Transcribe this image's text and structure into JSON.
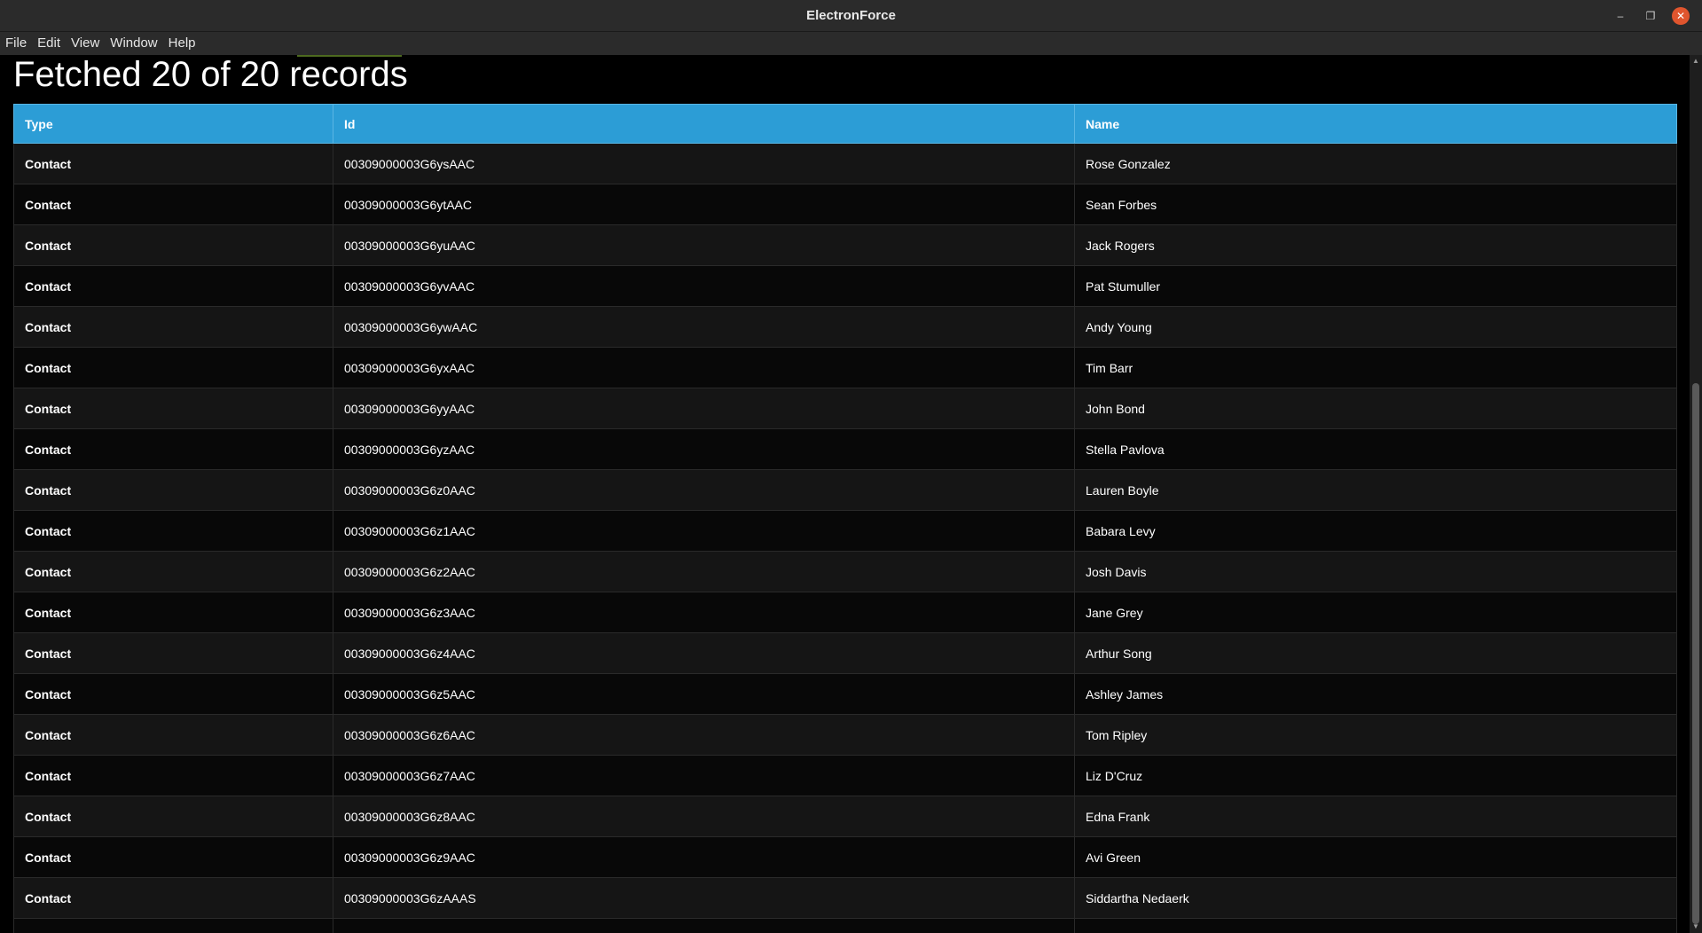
{
  "window": {
    "title": "ElectronForce",
    "controls": {
      "minimize": "–",
      "maximize": "❐",
      "close": "✕"
    }
  },
  "menu": {
    "items": [
      {
        "label": "File"
      },
      {
        "label": "Edit"
      },
      {
        "label": "View"
      },
      {
        "label": "Window"
      },
      {
        "label": "Help"
      }
    ]
  },
  "main": {
    "title": "Fetched 20 of 20 records",
    "table": {
      "headers": [
        "Type",
        "Id",
        "Name"
      ],
      "rows": [
        {
          "type": "Contact",
          "id": "00309000003G6ysAAC",
          "name": "Rose Gonzalez"
        },
        {
          "type": "Contact",
          "id": "00309000003G6ytAAC",
          "name": "Sean Forbes"
        },
        {
          "type": "Contact",
          "id": "00309000003G6yuAAC",
          "name": "Jack Rogers"
        },
        {
          "type": "Contact",
          "id": "00309000003G6yvAAC",
          "name": "Pat Stumuller"
        },
        {
          "type": "Contact",
          "id": "00309000003G6ywAAC",
          "name": "Andy Young"
        },
        {
          "type": "Contact",
          "id": "00309000003G6yxAAC",
          "name": "Tim Barr"
        },
        {
          "type": "Contact",
          "id": "00309000003G6yyAAC",
          "name": "John Bond"
        },
        {
          "type": "Contact",
          "id": "00309000003G6yzAAC",
          "name": "Stella Pavlova"
        },
        {
          "type": "Contact",
          "id": "00309000003G6z0AAC",
          "name": "Lauren Boyle"
        },
        {
          "type": "Contact",
          "id": "00309000003G6z1AAC",
          "name": "Babara Levy"
        },
        {
          "type": "Contact",
          "id": "00309000003G6z2AAC",
          "name": "Josh Davis"
        },
        {
          "type": "Contact",
          "id": "00309000003G6z3AAC",
          "name": "Jane Grey"
        },
        {
          "type": "Contact",
          "id": "00309000003G6z4AAC",
          "name": "Arthur Song"
        },
        {
          "type": "Contact",
          "id": "00309000003G6z5AAC",
          "name": "Ashley James"
        },
        {
          "type": "Contact",
          "id": "00309000003G6z6AAC",
          "name": "Tom Ripley"
        },
        {
          "type": "Contact",
          "id": "00309000003G6z7AAC",
          "name": "Liz D'Cruz"
        },
        {
          "type": "Contact",
          "id": "00309000003G6z8AAC",
          "name": "Edna Frank"
        },
        {
          "type": "Contact",
          "id": "00309000003G6z9AAC",
          "name": "Avi Green"
        },
        {
          "type": "Contact",
          "id": "00309000003G6zAAAS",
          "name": "Siddartha Nedaerk"
        },
        {
          "type": "",
          "id": "",
          "name": ""
        }
      ]
    }
  },
  "colors": {
    "header_accent": "#2c9dd6",
    "close_button": "#e0552e",
    "background": "#000000"
  }
}
